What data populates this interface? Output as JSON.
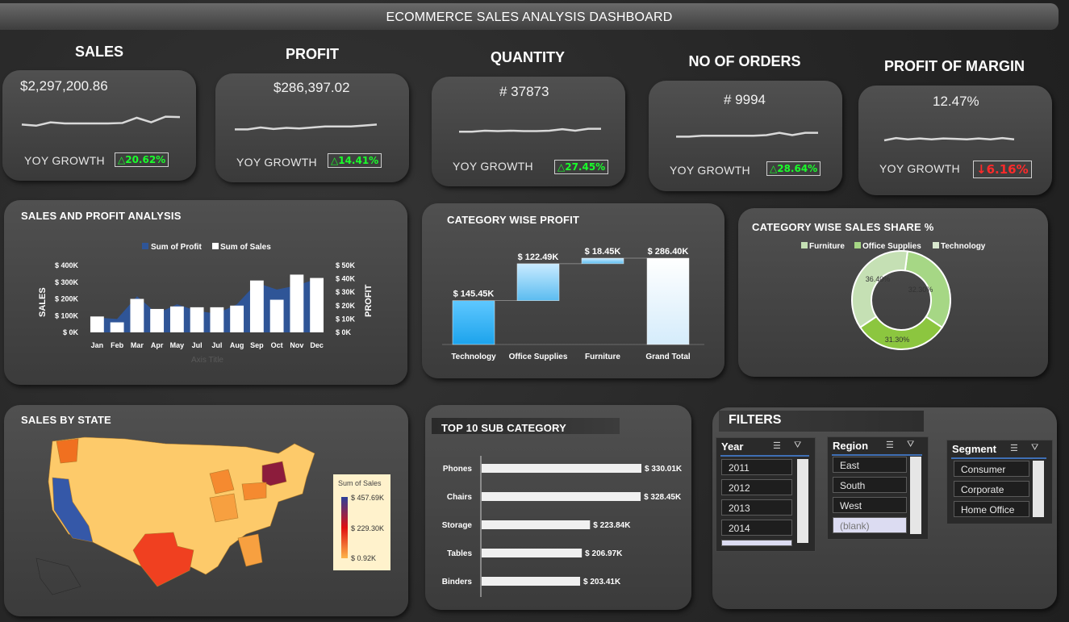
{
  "title": "ECOMMERCE SALES ANALYSIS DASHBOARD",
  "kpis": [
    {
      "title": "SALES",
      "value": "$2,297,200.86",
      "yoy_label": "YOY GROWTH",
      "yoy": "△20.62%",
      "trend": "up",
      "spark": [
        0.45,
        0.4,
        0.55,
        0.5,
        0.5,
        0.5,
        0.5,
        0.52,
        0.75,
        0.55,
        0.8,
        0.78
      ]
    },
    {
      "title": "PROFIT",
      "value": "$286,397.02",
      "yoy_label": "YOY GROWTH",
      "yoy": "△14.41%",
      "trend": "up",
      "spark": [
        0.4,
        0.4,
        0.5,
        0.42,
        0.48,
        0.45,
        0.5,
        0.55,
        0.55,
        0.55,
        0.6,
        0.65
      ]
    },
    {
      "title": "QUANTITY",
      "value": "# 37873",
      "yoy_label": "YOY GROWTH",
      "yoy": "△27.45%",
      "trend": "up",
      "spark": [
        0.45,
        0.45,
        0.5,
        0.48,
        0.5,
        0.48,
        0.48,
        0.5,
        0.58,
        0.5,
        0.6,
        0.6
      ]
    },
    {
      "title": "NO OF ORDERS",
      "value": "# 9994",
      "yoy_label": "YOY GROWTH",
      "yoy": "△28.64%",
      "trend": "up",
      "spark": [
        0.4,
        0.4,
        0.45,
        0.45,
        0.45,
        0.45,
        0.45,
        0.48,
        0.6,
        0.48,
        0.6,
        0.6
      ]
    },
    {
      "title": "PROFIT OF MARGIN",
      "value": "12.47%",
      "yoy_label": "YOY GROWTH",
      "yoy": "↓6.16%",
      "trend": "down",
      "spark": [
        0.5,
        0.62,
        0.55,
        0.6,
        0.55,
        0.6,
        0.58,
        0.55,
        0.6,
        0.55,
        0.62,
        0.55
      ]
    }
  ],
  "sales_profit": {
    "title": "SALES AND PROFIT ANALYSIS",
    "legend_profit": "Sum of Profit",
    "legend_sales": "Sum of Sales",
    "ylabel_left": "SALES",
    "ylabel_right": "PROFIT",
    "xlabel": "Axis Title",
    "left_ticks": [
      "$ 400K",
      "$ 300K",
      "$ 200K",
      "$ 100K",
      "$ 0K"
    ],
    "right_ticks": [
      "$ 50K",
      "$ 40K",
      "$ 30K",
      "$ 20K",
      "$ 10K",
      "$ 0K"
    ],
    "months": [
      "Jan",
      "Feb",
      "Mar",
      "Apr",
      "May",
      "Jul",
      "Jul",
      "Aug",
      "Sep",
      "Oct",
      "Nov",
      "Dec"
    ]
  },
  "category_profit": {
    "title": "CATEGORY WISE PROFIT",
    "labels": [
      "$ 145.45K",
      "$ 122.49K",
      "$ 18.45K",
      "$ 286.40K"
    ],
    "categories": [
      "Technology",
      "Office Supplies",
      "Furniture",
      "Grand Total"
    ]
  },
  "sales_share": {
    "title": "CATEGORY WISE SALES SHARE %",
    "legend": [
      "Furniture",
      "Office Supplies",
      "Technology"
    ],
    "labels": [
      "36.40%",
      "32.30%",
      "31.30%"
    ]
  },
  "state": {
    "title": "SALES BY STATE",
    "legend_title": "Sum of Sales",
    "legend_max": "$ 457.69K",
    "legend_mid": "$ 229.30K",
    "legend_min": "$ 0.92K"
  },
  "top10": {
    "title": "TOP 10 SUB CATEGORY",
    "items": [
      {
        "name": "Phones",
        "label": "$ 330.01K"
      },
      {
        "name": "Chairs",
        "label": "$ 328.45K"
      },
      {
        "name": "Storage",
        "label": "$ 223.84K"
      },
      {
        "name": "Tables",
        "label": "$ 206.97K"
      },
      {
        "name": "Binders",
        "label": "$ 203.41K"
      }
    ]
  },
  "filters": {
    "title": "FILTERS",
    "year": {
      "label": "Year",
      "items": [
        "2011",
        "2012",
        "2013",
        "2014"
      ]
    },
    "region": {
      "label": "Region",
      "items": [
        "East",
        "South",
        "West",
        "(blank)"
      ]
    },
    "segment": {
      "label": "Segment",
      "items": [
        "Consumer",
        "Corporate",
        "Home Office"
      ]
    }
  },
  "chart_data": [
    {
      "type": "bar",
      "title": "SALES AND PROFIT ANALYSIS",
      "categories": [
        "Jan",
        "Feb",
        "Mar",
        "Apr",
        "May",
        "Jul",
        "Jul",
        "Aug",
        "Sep",
        "Oct",
        "Nov",
        "Dec"
      ],
      "series": [
        {
          "name": "Sum of Sales",
          "axis": "left",
          "values": [
            95000,
            60000,
            200000,
            140000,
            155000,
            150000,
            150000,
            160000,
            310000,
            195000,
            345000,
            325000
          ]
        },
        {
          "name": "Sum of Profit",
          "axis": "right",
          "values": [
            11000,
            10000,
            27000,
            14000,
            21000,
            16000,
            14000,
            21000,
            37000,
            32000,
            35000,
            40000
          ]
        }
      ],
      "ylabel": "SALES",
      "y2label": "PROFIT",
      "xlabel": "Axis Title",
      "ylim": [
        0,
        400000
      ],
      "y2lim": [
        0,
        50000
      ],
      "legend": "top"
    },
    {
      "type": "bar",
      "title": "CATEGORY WISE PROFIT",
      "subtype": "waterfall",
      "categories": [
        "Technology",
        "Office Supplies",
        "Furniture",
        "Grand Total"
      ],
      "values": [
        145450,
        122490,
        18450,
        286400
      ]
    },
    {
      "type": "pie",
      "title": "CATEGORY WISE SALES SHARE %",
      "subtype": "donut",
      "categories": [
        "Furniture",
        "Office Supplies",
        "Technology"
      ],
      "values": [
        32.3,
        31.3,
        36.4
      ],
      "colors": [
        "#a6d785",
        "#8cc63f",
        "#c5e0b4"
      ],
      "legend": "top"
    },
    {
      "type": "bar",
      "title": "TOP 10 SUB CATEGORY",
      "orientation": "horizontal",
      "categories": [
        "Phones",
        "Chairs",
        "Storage",
        "Tables",
        "Binders"
      ],
      "values": [
        330010,
        328450,
        223840,
        206970,
        203410
      ]
    }
  ]
}
